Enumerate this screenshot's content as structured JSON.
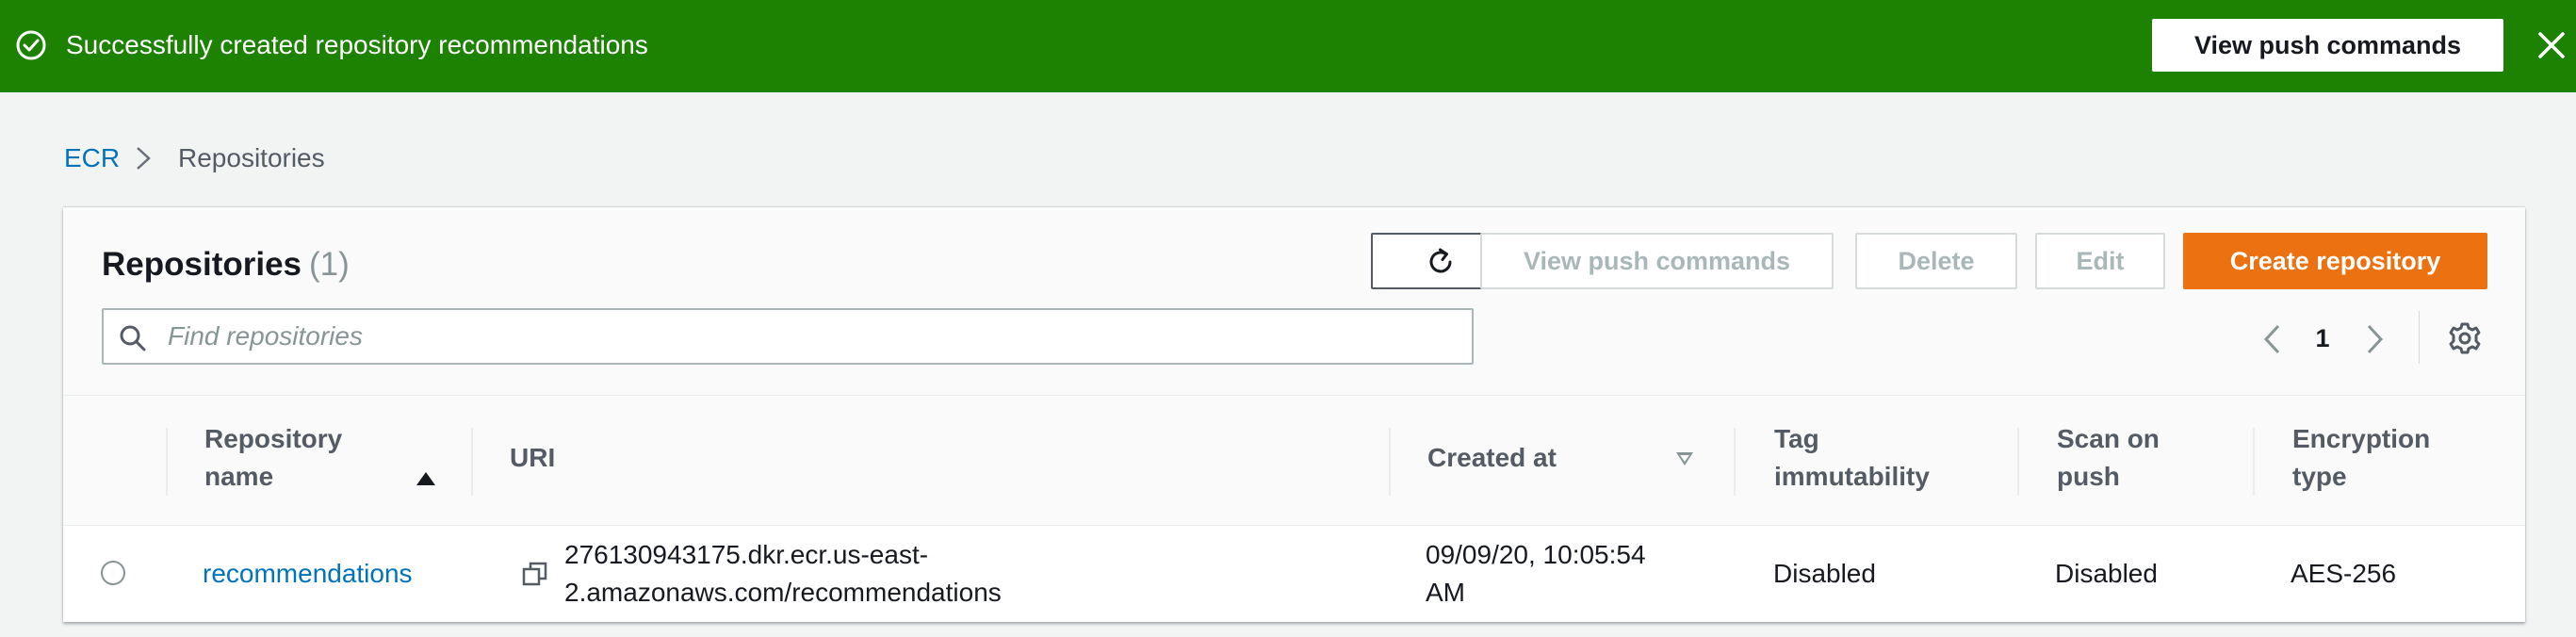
{
  "flash": {
    "message": "Successfully created repository recommendations",
    "action_label": "View push commands",
    "color": "#1d8102"
  },
  "breadcrumb": {
    "root": "ECR",
    "current": "Repositories"
  },
  "panel": {
    "title": "Repositories",
    "count": "(1)",
    "buttons": {
      "view_push_commands": "View push commands",
      "delete": "Delete",
      "edit": "Edit",
      "create": "Create repository"
    },
    "search_placeholder": "Find repositories",
    "page": "1"
  },
  "table": {
    "columns": [
      {
        "line1": "Repository",
        "line2": "name"
      },
      {
        "line1": "URI",
        "line2": ""
      },
      {
        "line1": "Created at",
        "line2": ""
      },
      {
        "line1": "Tag",
        "line2": "immutability"
      },
      {
        "line1": "Scan on",
        "line2": "push"
      },
      {
        "line1": "Encryption",
        "line2": "type"
      }
    ],
    "rows": [
      {
        "name": "recommendations",
        "uri_line1": "276130943175.dkr.ecr.us-east-",
        "uri_line2": "2.amazonaws.com/recommendations",
        "created_line1": "09/09/20, 10:05:54",
        "created_line2": "AM",
        "tag_immutability": "Disabled",
        "scan_on_push": "Disabled",
        "encryption": "AES-256"
      }
    ]
  },
  "colors": {
    "accent_orange": "#ec7211",
    "link_blue": "#0073bb",
    "success_green": "#1d8102"
  }
}
